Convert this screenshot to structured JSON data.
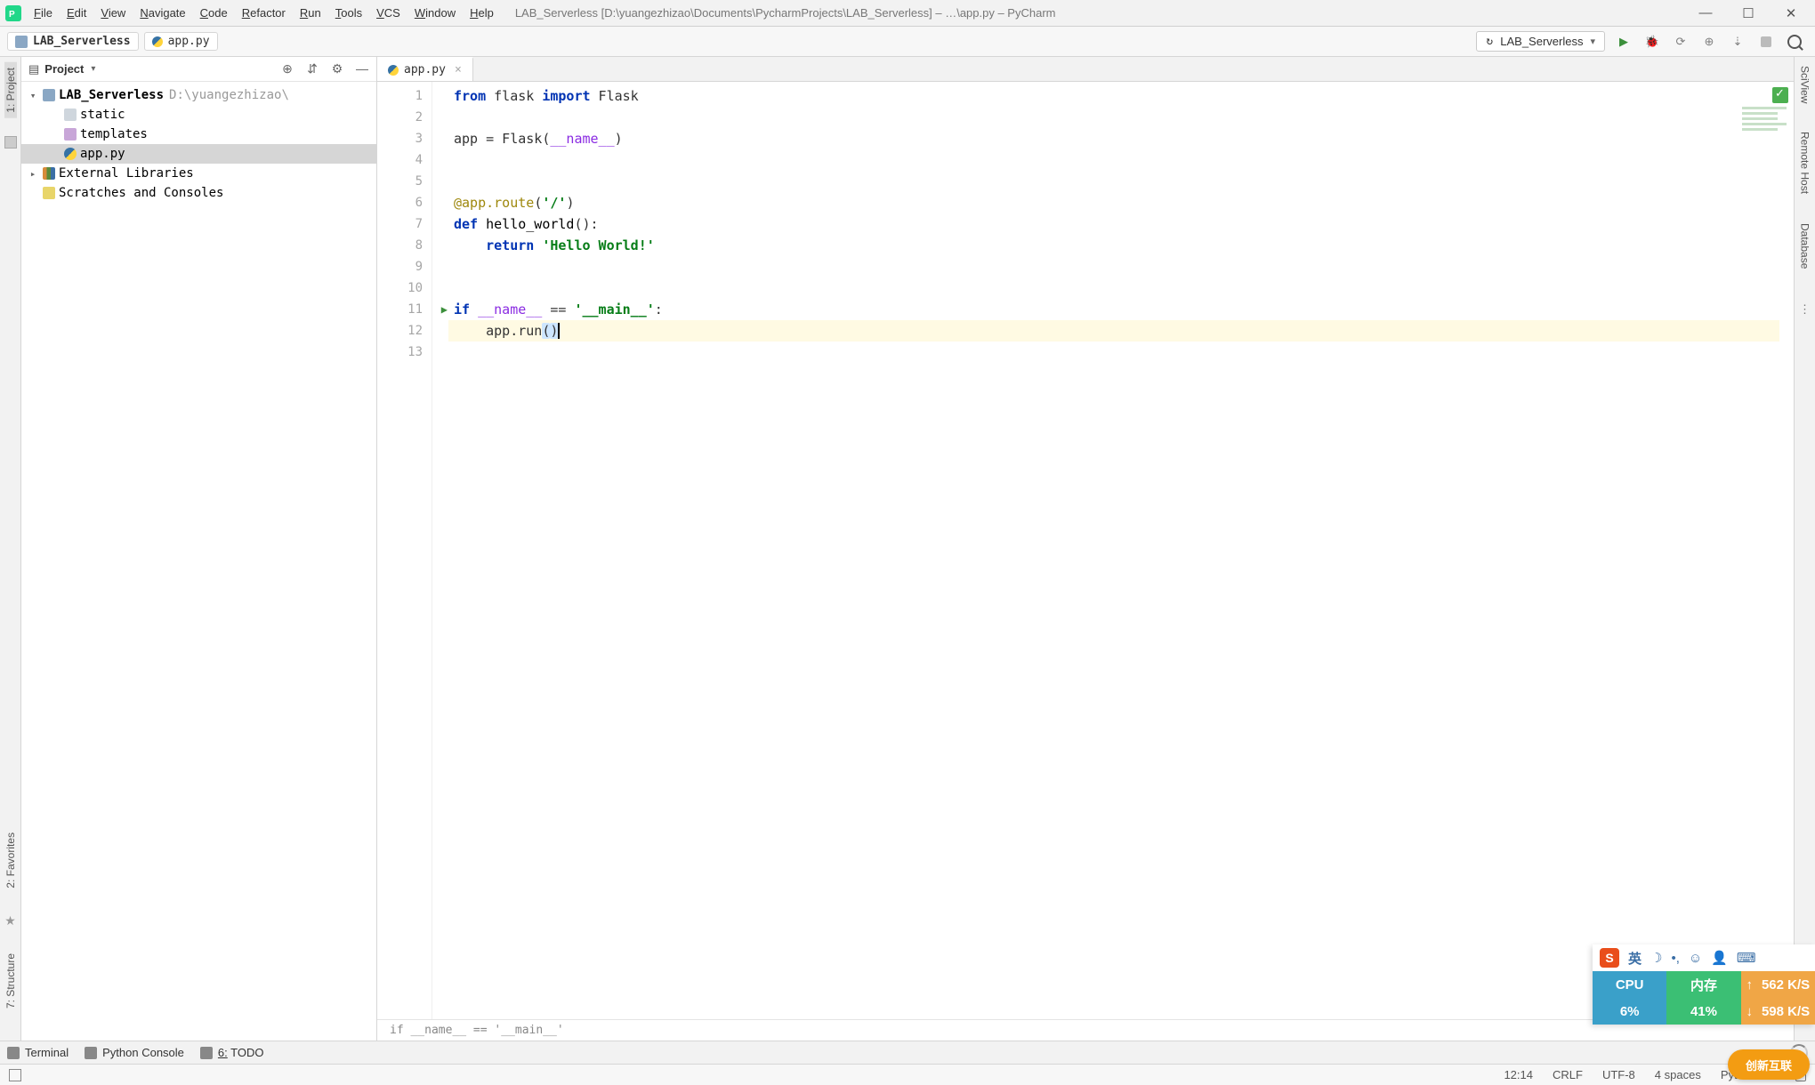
{
  "menu": {
    "items": [
      "File",
      "Edit",
      "View",
      "Navigate",
      "Code",
      "Refactor",
      "Run",
      "Tools",
      "VCS",
      "Window",
      "Help"
    ],
    "title": "LAB_Serverless [D:\\yuangezhizao\\Documents\\PycharmProjects\\LAB_Serverless] – …\\app.py – PyCharm"
  },
  "breadcrumb": {
    "project": "LAB_Serverless",
    "file": "app.py"
  },
  "run_config": {
    "name": "LAB_Serverless"
  },
  "project_panel": {
    "title": "Project",
    "root": "LAB_Serverless",
    "root_path": "D:\\yuangezhizao\\",
    "children": [
      {
        "name": "static",
        "type": "dir"
      },
      {
        "name": "templates",
        "type": "tpl"
      },
      {
        "name": "app.py",
        "type": "py",
        "selected": true
      }
    ],
    "external": "External Libraries",
    "scratches": "Scratches and Consoles"
  },
  "tabs": [
    {
      "name": "app.py"
    }
  ],
  "code": {
    "lines": [
      {
        "n": 1,
        "html": "<span class='kw'>from</span> flask <span class='kw'>import</span> Flask"
      },
      {
        "n": 2,
        "html": ""
      },
      {
        "n": 3,
        "html": "app = Flask(<span class='dunder'>__name__</span>)"
      },
      {
        "n": 4,
        "html": ""
      },
      {
        "n": 5,
        "html": ""
      },
      {
        "n": 6,
        "html": "<span class='dec'>@app.route</span>(<span class='str'>'/'</span>)"
      },
      {
        "n": 7,
        "html": "<span class='kw'>def</span> <span class='fn'>hello_world</span>():"
      },
      {
        "n": 8,
        "html": "    <span class='kw'>return</span> <span class='str'>'Hello World!'</span>"
      },
      {
        "n": 9,
        "html": ""
      },
      {
        "n": 10,
        "html": ""
      },
      {
        "n": 11,
        "html": "<span class='kw'>if</span> <span class='dunder'>__name__</span> == <span class='str'>'__main__'</span>:",
        "run": true
      },
      {
        "n": 12,
        "html": "    app.run<span class='paren-hl'>(</span><span class='paren-hl'>)</span><span class='caret'></span>",
        "current": true
      },
      {
        "n": 13,
        "html": ""
      }
    ],
    "context": "if __name__ == '__main__'"
  },
  "bottom_bar": {
    "terminal": "Terminal",
    "python_console": "Python Console",
    "todo_prefix": "6:",
    "todo": "TODO"
  },
  "status": {
    "pos": "12:14",
    "eol": "CRLF",
    "enc": "UTF-8",
    "indent": "4 spaces",
    "interpreter": "Python 3.8"
  },
  "left_tools": {
    "project": "1: Project",
    "structure": "7: Structure",
    "favorites": "2: Favorites"
  },
  "right_tools": {
    "sciview": "SciView",
    "remote": "Remote Host",
    "database": "Database"
  },
  "sys_widget": {
    "ime": "英",
    "cpu_label": "CPU",
    "cpu_val": "6%",
    "mem_label": "内存",
    "mem_val": "41%",
    "up": "562 K/S",
    "down": "598 K/S"
  },
  "orange_badge": "创新互联"
}
